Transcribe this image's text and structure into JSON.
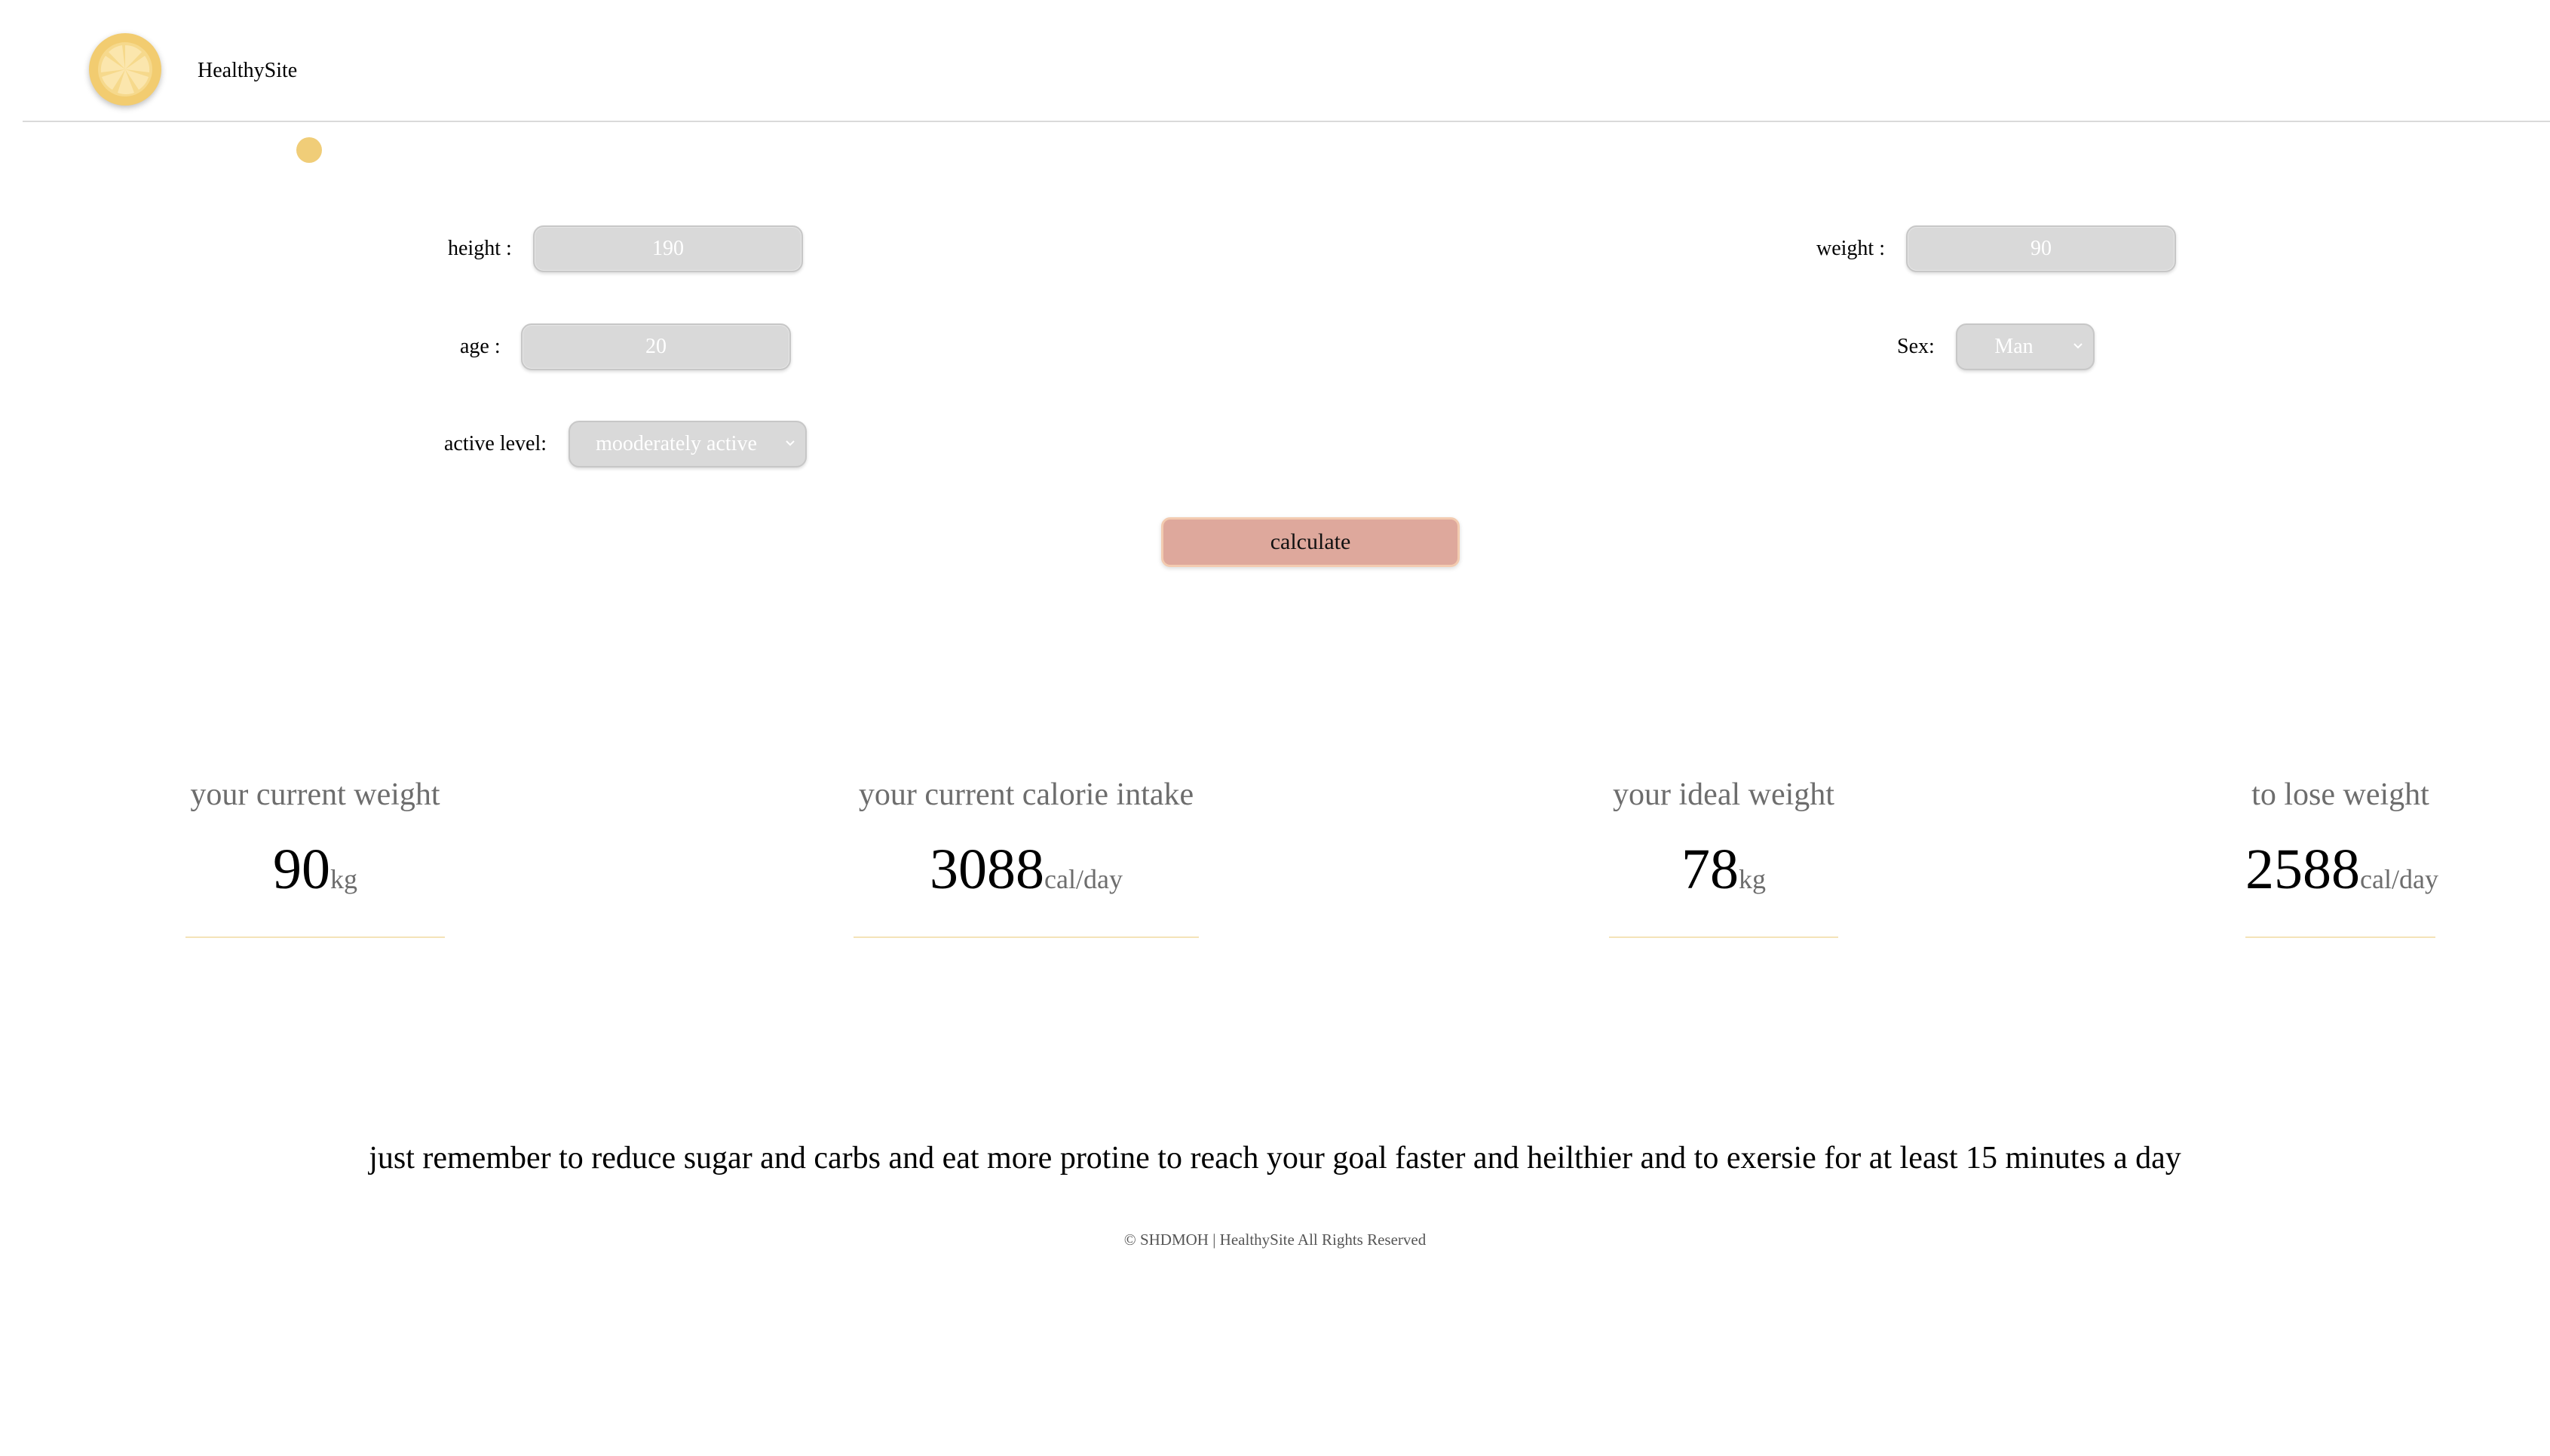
{
  "header": {
    "site_name": "HealthySite",
    "logo_icon": "citrus-slice-icon"
  },
  "form": {
    "height": {
      "label": "height :",
      "value": "190"
    },
    "weight": {
      "label": "weight :",
      "value": "90"
    },
    "age": {
      "label": "age :",
      "value": "20"
    },
    "sex": {
      "label": "Sex:",
      "selected": "Man"
    },
    "active_level": {
      "label": "active level:",
      "selected": "mooderately active"
    },
    "calculate_label": "calculate"
  },
  "results": [
    {
      "title": "your current weight",
      "value": "90",
      "unit": "kg"
    },
    {
      "title": "your current calorie intake",
      "value": "3088",
      "unit": "cal/day"
    },
    {
      "title": "your ideal weight",
      "value": "78",
      "unit": "kg"
    },
    {
      "title": "to lose weight",
      "value": "2588",
      "unit": "cal/day"
    }
  ],
  "tip": "just remember to reduce sugar and carbs and eat more protine to reach your goal faster and heilthier and to exersie for at least 15 minutes a day",
  "footer": "© SHDMOH | HealthySite All Rights Reserved",
  "colors": {
    "accent_yellow": "#f2cc70",
    "button": "#dea89c",
    "input_bg": "#d9d9d9"
  }
}
